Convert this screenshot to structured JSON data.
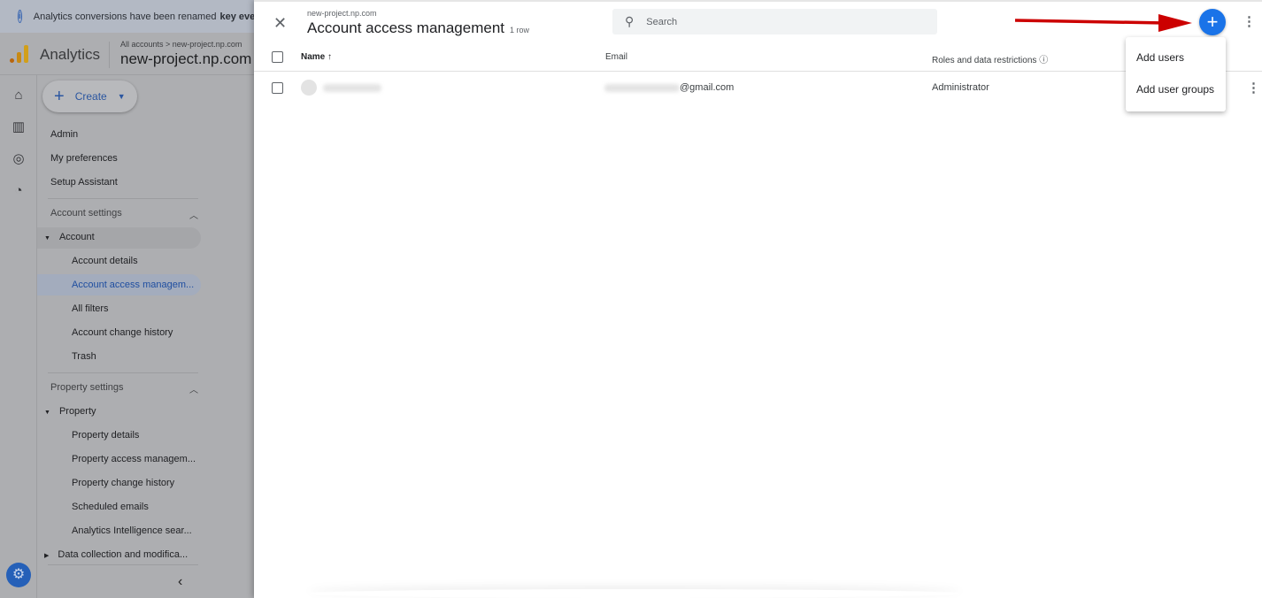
{
  "banner": {
    "text": "Analytics conversions have been renamed",
    "bold": "key eve"
  },
  "header": {
    "app_name": "Analytics",
    "breadcrumb": "All accounts > new-project.np.com",
    "property": "new-project.np.com"
  },
  "create": {
    "label": "Create"
  },
  "nav": {
    "top": [
      "Admin",
      "My preferences",
      "Setup Assistant"
    ],
    "account_settings": "Account settings",
    "account": "Account",
    "account_items": [
      "Account details",
      "Account access managem...",
      "All filters",
      "Account change history",
      "Trash"
    ],
    "property_settings": "Property settings",
    "property": "Property",
    "property_items": [
      "Property details",
      "Property access managem...",
      "Property change history",
      "Scheduled emails",
      "Analytics Intelligence sear..."
    ],
    "data_collection": "Data collection and modifica..."
  },
  "panel": {
    "subtitle": "new-project.np.com",
    "title": "Account access management",
    "row_count": "1 row",
    "search_placeholder": "Search",
    "columns": {
      "name": "Name",
      "email": "Email",
      "roles": "Roles and data restrictions"
    },
    "rows": [
      {
        "email_suffix": "@gmail.com",
        "role": "Administrator"
      }
    ],
    "menu": [
      "Add users",
      "Add user groups"
    ]
  },
  "colors": {
    "accent": "#1a73e8",
    "arrow": "#cc0000"
  }
}
